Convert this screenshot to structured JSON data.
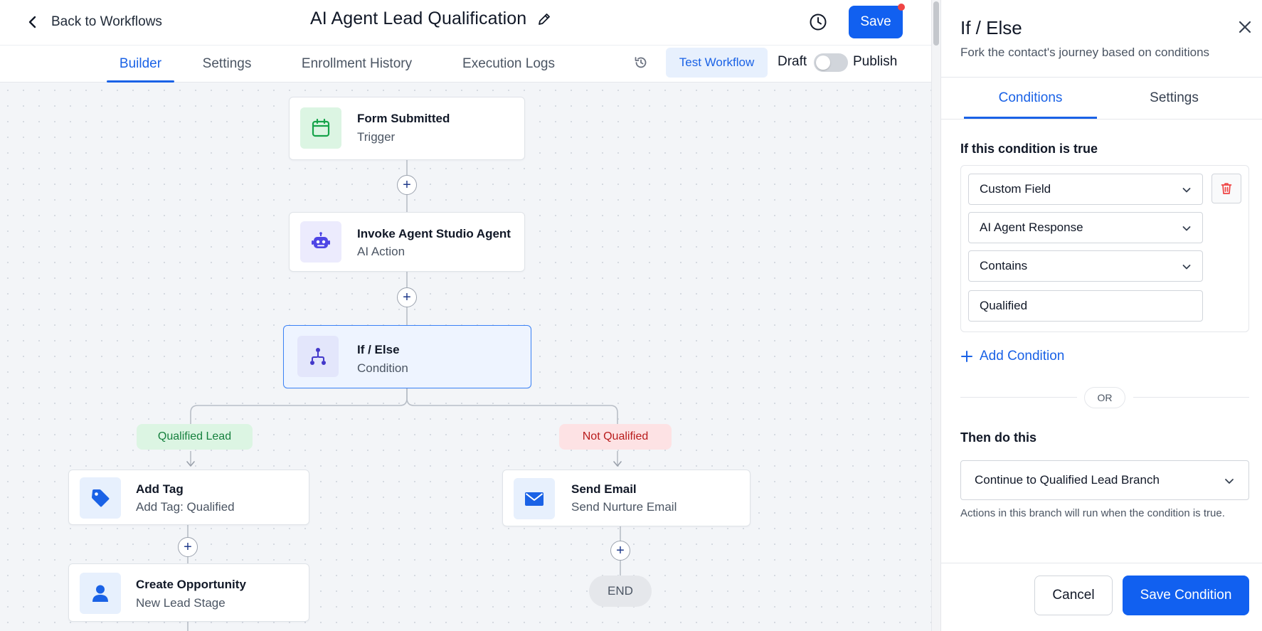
{
  "header": {
    "back_label": "Back to Workflows",
    "workflow_title": "AI Agent Lead Qualification",
    "save_label": "Save"
  },
  "tabs": [
    {
      "label": "Builder",
      "active": true
    },
    {
      "label": "Settings",
      "active": false
    },
    {
      "label": "Enrollment History",
      "active": false
    },
    {
      "label": "Execution Logs",
      "active": false
    }
  ],
  "toolbar": {
    "test_label": "Test Workflow",
    "draft_label": "Draft",
    "publish_label": "Publish",
    "published": false
  },
  "nodes": {
    "trigger": {
      "title": "Form Submitted",
      "subtitle": "Trigger",
      "icon": "calendar-icon"
    },
    "agent": {
      "title": "Invoke Agent Studio Agent",
      "subtitle": "AI Action",
      "icon": "robot-icon"
    },
    "ifelse": {
      "title": "If / Else",
      "subtitle": "Condition",
      "icon": "branch-icon"
    },
    "add_tag": {
      "title": "Add Tag",
      "subtitle": "Add Tag: Qualified",
      "icon": "tag-icon"
    },
    "send_email": {
      "title": "Send Email",
      "subtitle": "Send Nurture Email",
      "icon": "mail-icon"
    },
    "create_opp": {
      "title": "Create Opportunity",
      "subtitle": "New Lead Stage",
      "icon": "user-icon"
    }
  },
  "branches": {
    "yes_label": "Qualified Lead",
    "no_label": "Not Qualified"
  },
  "end_label": "END",
  "panel": {
    "title": "If / Else",
    "subtitle": "Fork the contact's journey based on conditions",
    "tabs": [
      {
        "label": "Conditions",
        "active": true
      },
      {
        "label": "Settings",
        "active": false
      }
    ],
    "if_label": "If this condition is true",
    "condition": {
      "field_type": "Custom Field",
      "field": "AI Agent Response",
      "operator": "Contains",
      "value": "Qualified"
    },
    "add_condition_label": "Add Condition",
    "or_label": "OR",
    "then_label": "Then do this",
    "then_value": "Continue to Qualified Lead Branch",
    "helper_text": "Actions in this branch will run when the condition is true.",
    "cancel_label": "Cancel",
    "save_label": "Save Condition"
  },
  "colors": {
    "primary": "#1160f0",
    "accent_blue": "#1a62e6",
    "qualified_bg": "#dcf5e3",
    "qualified_text": "#15803d",
    "not_qualified_bg": "#fde2e4",
    "not_qualified_text": "#b91c1c",
    "delete_red": "#ef4444"
  }
}
